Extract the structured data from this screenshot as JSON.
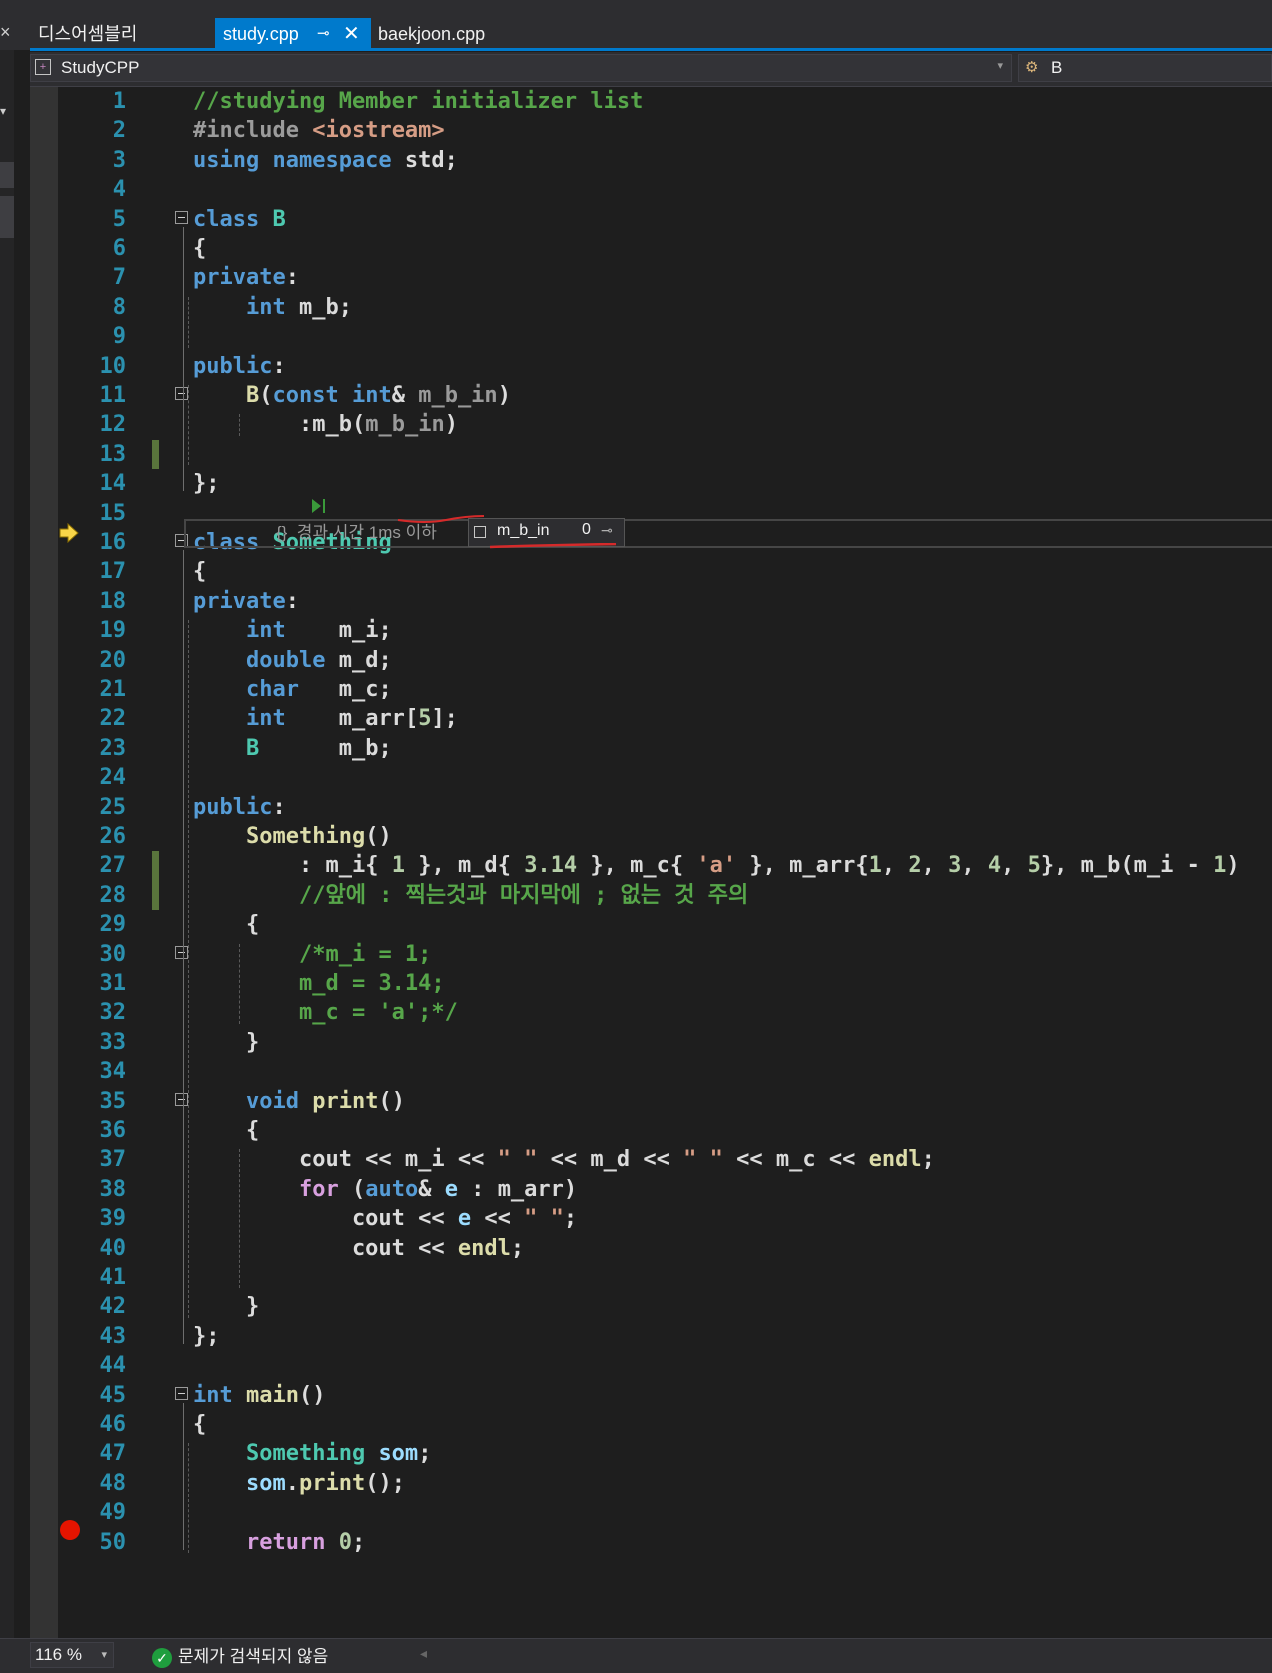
{
  "tabs": [
    {
      "label": "디스어셈블리"
    },
    {
      "label": "study.cpp",
      "pin": "⊸",
      "close": "✕"
    },
    {
      "label": "baekjoon.cpp"
    }
  ],
  "left_panel_glyph": "×",
  "navbar": {
    "project": "StudyCPP",
    "member": "B"
  },
  "perf_tip": "{}  경과 시간 1ms 이하",
  "data_tip": {
    "name": "m_b_in",
    "value": "0"
  },
  "statusbar": {
    "zoom": "116 %",
    "issues": "문제가 검색되지 않음"
  },
  "code_lines": [
    {
      "n": "1",
      "tokens": [
        [
          "cm",
          "//studying Member initializer list"
        ]
      ]
    },
    {
      "n": "2",
      "tokens": [
        [
          "pp",
          "#include "
        ],
        [
          "inc",
          "<iostream>"
        ]
      ]
    },
    {
      "n": "3",
      "tokens": [
        [
          "kw",
          "using namespace "
        ],
        [
          "",
          "std;"
        ]
      ]
    },
    {
      "n": "4",
      "tokens": []
    },
    {
      "n": "5",
      "tokens": [
        [
          "kw",
          "class "
        ],
        [
          "ty",
          "B"
        ]
      ]
    },
    {
      "n": "6",
      "tokens": [
        [
          "",
          "{"
        ]
      ]
    },
    {
      "n": "7",
      "tokens": [
        [
          "kw",
          "private"
        ],
        [
          "",
          ":"
        ]
      ]
    },
    {
      "n": "8",
      "tokens": [
        [
          "",
          "    "
        ],
        [
          "kw",
          "int "
        ],
        [
          "mem",
          "m_b"
        ],
        [
          "",
          ";"
        ]
      ]
    },
    {
      "n": "9",
      "tokens": []
    },
    {
      "n": "10",
      "tokens": [
        [
          "kw",
          "public"
        ],
        [
          "",
          ":"
        ]
      ]
    },
    {
      "n": "11",
      "tokens": [
        [
          "",
          "    "
        ],
        [
          "fn",
          "B"
        ],
        [
          "",
          "("
        ],
        [
          "kw",
          "const int"
        ],
        [
          "",
          "& "
        ],
        [
          "par",
          "m_b_in"
        ],
        [
          "",
          ")"
        ]
      ]
    },
    {
      "n": "12",
      "tokens": [
        [
          "",
          "        :"
        ],
        [
          "mem",
          "m_b"
        ],
        [
          "",
          "("
        ],
        [
          "par",
          "m_b_in"
        ],
        [
          "",
          ")"
        ]
      ]
    },
    {
      "n": "13",
      "tokens": []
    },
    {
      "n": "14",
      "tokens": [
        [
          "",
          "};"
        ]
      ]
    },
    {
      "n": "15",
      "tokens": []
    },
    {
      "n": "16",
      "tokens": [
        [
          "kw",
          "class "
        ],
        [
          "ty",
          "Something"
        ]
      ]
    },
    {
      "n": "17",
      "tokens": [
        [
          "",
          "{"
        ]
      ]
    },
    {
      "n": "18",
      "tokens": [
        [
          "kw",
          "private"
        ],
        [
          "",
          ":"
        ]
      ]
    },
    {
      "n": "19",
      "tokens": [
        [
          "",
          "    "
        ],
        [
          "kw",
          "int    "
        ],
        [
          "mem",
          "m_i"
        ],
        [
          "",
          ";"
        ]
      ]
    },
    {
      "n": "20",
      "tokens": [
        [
          "",
          "    "
        ],
        [
          "kw",
          "double "
        ],
        [
          "mem",
          "m_d"
        ],
        [
          "",
          ";"
        ]
      ]
    },
    {
      "n": "21",
      "tokens": [
        [
          "",
          "    "
        ],
        [
          "kw",
          "char   "
        ],
        [
          "mem",
          "m_c"
        ],
        [
          "",
          ";"
        ]
      ]
    },
    {
      "n": "22",
      "tokens": [
        [
          "",
          "    "
        ],
        [
          "kw",
          "int    "
        ],
        [
          "mem",
          "m_arr"
        ],
        [
          "",
          "["
        ],
        [
          "num",
          "5"
        ],
        [
          "",
          "];"
        ]
      ]
    },
    {
      "n": "23",
      "tokens": [
        [
          "",
          "    "
        ],
        [
          "ty",
          "B      "
        ],
        [
          "mem",
          "m_b"
        ],
        [
          "",
          ";"
        ]
      ]
    },
    {
      "n": "24",
      "tokens": []
    },
    {
      "n": "25",
      "tokens": [
        [
          "kw",
          "public"
        ],
        [
          "",
          ":"
        ]
      ]
    },
    {
      "n": "26",
      "tokens": [
        [
          "",
          "    "
        ],
        [
          "fn",
          "Something"
        ],
        [
          "",
          "()"
        ]
      ]
    },
    {
      "n": "27",
      "tokens": [
        [
          "",
          "        : "
        ],
        [
          "mem",
          "m_i"
        ],
        [
          "",
          "{ "
        ],
        [
          "num",
          "1"
        ],
        [
          "",
          "",
          " }, "
        ],
        [
          "mem",
          "m_d"
        ],
        [
          "",
          "{ "
        ],
        [
          "num",
          "3.14"
        ],
        [
          "",
          "",
          " }, "
        ],
        [
          "mem",
          "m_c"
        ],
        [
          "",
          "{ "
        ],
        [
          "str",
          "'a'"
        ],
        [
          "",
          "",
          " }, "
        ],
        [
          "mem",
          "m_arr"
        ],
        [
          "",
          "{"
        ],
        [
          "num",
          "1"
        ],
        [
          "",
          ", "
        ],
        [
          "num",
          "2"
        ],
        [
          "",
          ", "
        ],
        [
          "num",
          "3"
        ],
        [
          "",
          ", "
        ],
        [
          "num",
          "4"
        ],
        [
          "",
          ", "
        ],
        [
          "num",
          "5"
        ],
        [
          "",
          "}, "
        ],
        [
          "mem",
          "m_b"
        ],
        [
          "",
          "("
        ],
        [
          "mem",
          "m_i"
        ],
        [
          "",
          "",
          " - "
        ],
        [
          "num",
          "1"
        ],
        [
          "",
          ")"
        ]
      ]
    },
    {
      "n": "28",
      "tokens": [
        [
          "",
          "        "
        ],
        [
          "cm",
          "//앞에 : 찍는것과 마지막에 ; 없는 것 주의"
        ]
      ]
    },
    {
      "n": "29",
      "tokens": [
        [
          "",
          "    {"
        ]
      ]
    },
    {
      "n": "30",
      "tokens": [
        [
          "",
          "        "
        ],
        [
          "cm",
          "/*m_i = 1;"
        ]
      ]
    },
    {
      "n": "31",
      "tokens": [
        [
          "",
          "        "
        ],
        [
          "cm",
          "m_d = 3.14;"
        ]
      ]
    },
    {
      "n": "32",
      "tokens": [
        [
          "",
          "        "
        ],
        [
          "cm",
          "m_c = 'a';*/"
        ]
      ]
    },
    {
      "n": "33",
      "tokens": [
        [
          "",
          "    }"
        ]
      ]
    },
    {
      "n": "34",
      "tokens": []
    },
    {
      "n": "35",
      "tokens": [
        [
          "",
          "    "
        ],
        [
          "kw",
          "void "
        ],
        [
          "fn",
          "print"
        ],
        [
          "",
          "()"
        ]
      ]
    },
    {
      "n": "36",
      "tokens": [
        [
          "",
          "    {"
        ]
      ]
    },
    {
      "n": "37",
      "tokens": [
        [
          "",
          "        cout << "
        ],
        [
          "mem",
          "m_i"
        ],
        [
          "",
          "",
          " << "
        ],
        [
          "str",
          "\" \""
        ],
        [
          "",
          "",
          " << "
        ],
        [
          "mem",
          "m_d"
        ],
        [
          "",
          "",
          " << "
        ],
        [
          "str",
          "\" \""
        ],
        [
          "",
          "",
          " << "
        ],
        [
          "mem",
          "m_c"
        ],
        [
          "",
          "",
          " << "
        ],
        [
          "fn",
          "endl"
        ],
        [
          "",
          ";"
        ]
      ]
    },
    {
      "n": "38",
      "tokens": [
        [
          "",
          "        "
        ],
        [
          "fl",
          "for "
        ],
        [
          "",
          "("
        ],
        [
          "kw",
          "auto"
        ],
        [
          "",
          "& "
        ],
        [
          "var",
          "e"
        ],
        [
          "",
          "",
          " : "
        ],
        [
          "mem",
          "m_arr"
        ],
        [
          "",
          ")"
        ]
      ]
    },
    {
      "n": "39",
      "tokens": [
        [
          "",
          "            cout << "
        ],
        [
          "var",
          "e"
        ],
        [
          "",
          "",
          " << "
        ],
        [
          "str",
          "\" \""
        ],
        [
          "",
          ";"
        ]
      ]
    },
    {
      "n": "40",
      "tokens": [
        [
          "",
          "            cout << "
        ],
        [
          "fn",
          "endl"
        ],
        [
          "",
          ";"
        ]
      ]
    },
    {
      "n": "41",
      "tokens": []
    },
    {
      "n": "42",
      "tokens": [
        [
          "",
          "    }"
        ]
      ]
    },
    {
      "n": "43",
      "tokens": [
        [
          "",
          "};"
        ]
      ]
    },
    {
      "n": "44",
      "tokens": []
    },
    {
      "n": "45",
      "tokens": [
        [
          "kw",
          "int "
        ],
        [
          "fn",
          "main"
        ],
        [
          "",
          "()"
        ]
      ]
    },
    {
      "n": "46",
      "tokens": [
        [
          "",
          "{"
        ]
      ]
    },
    {
      "n": "47",
      "tokens": [
        [
          "",
          "    "
        ],
        [
          "ty",
          "Something "
        ],
        [
          "var",
          "som"
        ],
        [
          "",
          ";"
        ]
      ]
    },
    {
      "n": "48",
      "tokens": [
        [
          "",
          "    "
        ],
        [
          "var",
          "som"
        ],
        [
          "",
          "."
        ],
        [
          "fn",
          "print"
        ],
        [
          "",
          "();"
        ]
      ]
    },
    {
      "n": "49",
      "tokens": []
    },
    {
      "n": "50",
      "tokens": [
        [
          "",
          "    "
        ],
        [
          "fl",
          "return "
        ],
        [
          "num",
          "0"
        ],
        [
          "",
          ";"
        ]
      ]
    }
  ]
}
